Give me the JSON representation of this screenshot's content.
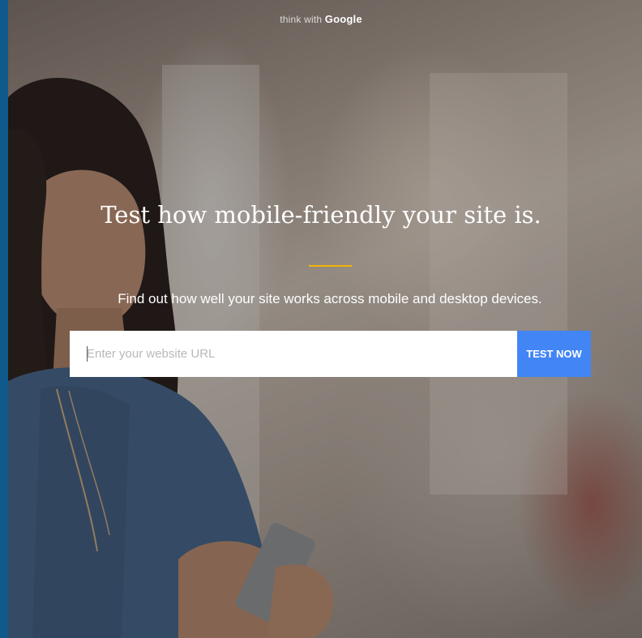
{
  "brand": {
    "prefix": "think with",
    "name": "Google"
  },
  "hero": {
    "headline": "Test how mobile-friendly your site is.",
    "subheadline": "Find out how well your site works across mobile and desktop devices.",
    "accent_color": "#f4b400"
  },
  "url_test": {
    "placeholder": "Enter your website URL",
    "value": "",
    "button_label": "TEST NOW",
    "button_color": "#4285f4"
  }
}
